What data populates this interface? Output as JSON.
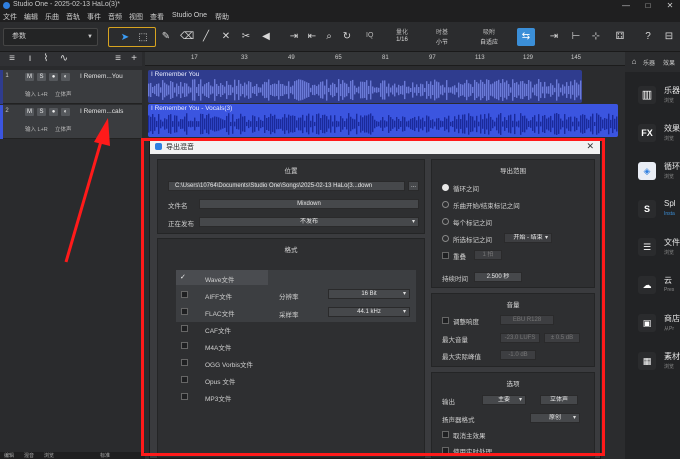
{
  "app": {
    "title": "Studio One - 2025-02-13 HaLo(3)*",
    "window_controls": [
      "—",
      "□",
      "✕"
    ]
  },
  "menu": [
    "文件",
    "编辑",
    "乐曲",
    "音轨",
    "事件",
    "音频",
    "视图",
    "查看",
    "Studio One",
    "帮助"
  ],
  "toolbar": {
    "preset_label": "参数",
    "quantize_label": "量化",
    "quantize_value": "1/16",
    "timebase_label": "时基",
    "timebase_value": "小节",
    "snap_label": "吸附",
    "snap_value": "自适应",
    "iq_label": "IQ"
  },
  "ruler": [
    "17",
    "33",
    "49",
    "65",
    "81",
    "97",
    "113",
    "129",
    "145"
  ],
  "tracks": [
    {
      "number": "1",
      "name": "I Remem...You",
      "io": "输入 L+R",
      "mode": "立体声"
    },
    {
      "number": "2",
      "name": "I Remem...cals",
      "io": "输入 L+R",
      "mode": "立体声"
    }
  ],
  "clips": [
    {
      "name": "I Remember You",
      "color": "#2f3c8e"
    },
    {
      "name": "I Remember You - Vocals(3)",
      "color": "#3b55e0"
    }
  ],
  "browser": {
    "tabs": [
      "乐器",
      "效果"
    ],
    "items": [
      {
        "icon": "instrument-icon",
        "title": "乐器",
        "sub": "浏览"
      },
      {
        "icon": "fx-icon",
        "title": "效果",
        "sub": "浏览"
      },
      {
        "icon": "loop-icon",
        "title": "循环",
        "sub": "浏览"
      },
      {
        "icon": "splice-icon",
        "title": "Spl",
        "sub": "Insta"
      },
      {
        "icon": "file-icon",
        "title": "文件",
        "sub": "浏览"
      },
      {
        "icon": "cloud-icon",
        "title": "云",
        "sub": "Pres"
      },
      {
        "icon": "shop-icon",
        "title": "商店",
        "sub": "从Pr"
      },
      {
        "icon": "pool-icon",
        "title": "素材",
        "sub": "浏览"
      }
    ]
  },
  "status": [
    "编辑",
    "混音",
    "浏览",
    "标准"
  ],
  "dialog": {
    "title": "导出混音",
    "location": {
      "heading": "位置",
      "path": "C:\\Users\\10764\\Documents\\Studio One\\Songs\\2025-02-13 HaLo(3...down",
      "browse_button": "...",
      "filename_label": "文件名",
      "filename_value": "Mixdown",
      "publish_label": "正在发布",
      "publish_value": "不发布"
    },
    "format": {
      "heading": "格式",
      "options": [
        "Wave文件",
        "AIFF文件",
        "FLAC文件",
        "CAF文件",
        "M4A文件",
        "OGG Vorbis文件",
        "Opus 文件",
        "MP3文件"
      ],
      "selected": "Wave文件",
      "resolution_label": "分辨率",
      "resolution_value": "16 Bit",
      "samplerate_label": "采样率",
      "samplerate_value": "44.1 kHz"
    },
    "range": {
      "heading": "导出范围",
      "options": [
        "循环之间",
        "乐曲开始/结束标记之间",
        "每个标记之间",
        "所选标记之间"
      ],
      "selected": "循环之间",
      "marker_select": "开始 - 结束",
      "overlap_label": "重叠",
      "overlap_value": "1 拍",
      "duration_label": "持续时间",
      "duration_value": "2.500 秒"
    },
    "loudness": {
      "heading": "音量",
      "adjust_label": "调整响度",
      "adjust_value": "EBU R128",
      "max_loudness_label": "最大音量",
      "max_loudness_value": "-23.0 LUFS",
      "max_loudness_tol": "± 0.5 dB",
      "max_peak_label": "最大实际峰值",
      "max_peak_value": "-1.0 dB"
    },
    "options": {
      "heading": "选项",
      "output_label": "输出",
      "output_value": "主要",
      "output_mode": "立体声",
      "speaker_label": "扬声器格式",
      "speaker_value": "原创",
      "cancel_master_label": "取消主效果",
      "realtime_label": "使用实时处理"
    }
  }
}
